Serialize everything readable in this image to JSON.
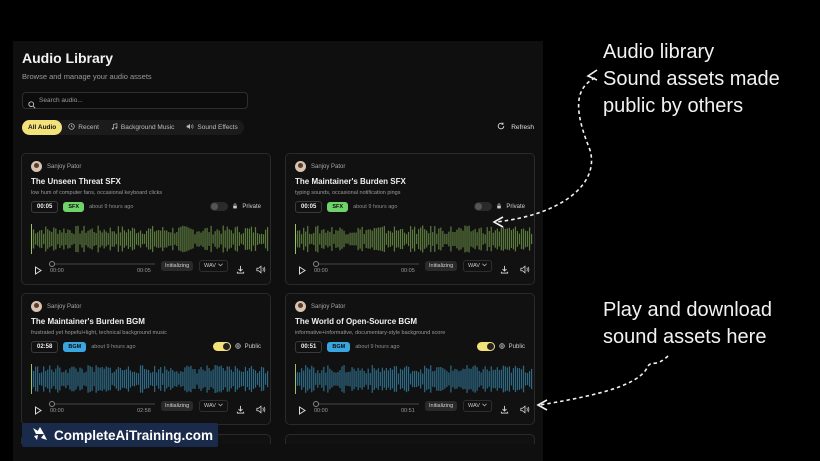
{
  "header": {
    "title": "Audio Library",
    "subtitle": "Browse and manage your audio assets"
  },
  "search": {
    "placeholder": "Search audio...",
    "value": ""
  },
  "tabs": [
    {
      "label": "All Audio",
      "icon": "none",
      "active": true
    },
    {
      "label": "Recent",
      "icon": "clock-icon",
      "active": false
    },
    {
      "label": "Background Music",
      "icon": "music-note-icon",
      "active": false
    },
    {
      "label": "Sound Effects",
      "icon": "speaker-icon",
      "active": false
    }
  ],
  "refresh_label": "Refresh",
  "cards": [
    {
      "author": "Sanjoy Pator",
      "title": "The Unseen Threat SFX",
      "description": "low hum of computer fans, occasional keyboard clicks",
      "duration": "00:05",
      "tag": "SFX",
      "time_ago": "about 9 hours ago",
      "visibility": "Private",
      "is_public": false,
      "current_time": "00:00",
      "total_time": "00:05",
      "status": "Initializing",
      "format": "WAV",
      "wave_color": "#5b7a3e"
    },
    {
      "author": "Sanjoy Pator",
      "title": "The Maintainer's Burden SFX",
      "description": "typing sounds, occasional notification pings",
      "duration": "00:05",
      "tag": "SFX",
      "time_ago": "about 9 hours ago",
      "visibility": "Private",
      "is_public": false,
      "current_time": "00:00",
      "total_time": "00:05",
      "status": "Initializing",
      "format": "WAV",
      "wave_color": "#5b7a3e"
    },
    {
      "author": "Sanjoy Pator",
      "title": "The Maintainer's Burden BGM",
      "description": "frustrated yet hopeful+light, technical background music",
      "duration": "02:58",
      "tag": "BGM",
      "time_ago": "about 9 hours ago",
      "visibility": "Public",
      "is_public": true,
      "current_time": "00:00",
      "total_time": "02:58",
      "status": "Initializing",
      "format": "WAV",
      "wave_color": "#2e6a86"
    },
    {
      "author": "Sanjoy Pator",
      "title": "The World of Open-Source BGM",
      "description": "informative+informative, documentary-style background score",
      "duration": "00:51",
      "tag": "BGM",
      "time_ago": "about 9 hours ago",
      "visibility": "Public",
      "is_public": true,
      "current_time": "00:00",
      "total_time": "00:51",
      "status": "Initializing",
      "format": "WAV",
      "wave_color": "#2e6a86"
    }
  ],
  "colors": {
    "accent": "#f3e17a",
    "sfx_badge": "#6fd36a",
    "bgm_badge": "#3aa6e0",
    "background": "#000000"
  },
  "annotations": {
    "top": [
      "Audio library",
      "Sound assets made",
      "public by others"
    ],
    "bottom": [
      "Play and download",
      "sound assets here"
    ]
  },
  "brand": {
    "label": "CompleteAiTraining.com"
  }
}
